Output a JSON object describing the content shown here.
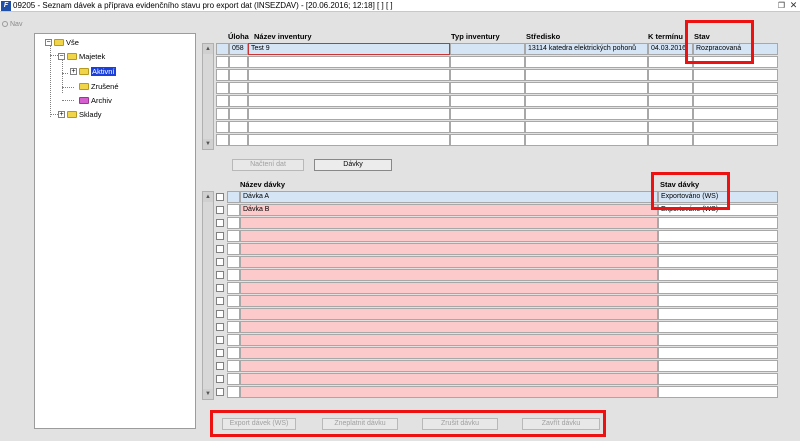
{
  "window": {
    "title": "09205 - Seznam dávek a příprava evidenčního stavu pro export dat (INSEZDAV) - [20.06.2016; 12:18]  [ ]  [ ]",
    "app_icon": "F"
  },
  "nav": {
    "label": "Nav"
  },
  "tree": {
    "root": "Vše",
    "majetek": "Majetek",
    "aktivni": "Aktivní",
    "zrusene": "Zrušené",
    "archiv": "Archiv",
    "sklady": "Sklady"
  },
  "inventory_grid": {
    "headers": {
      "uloha": "Úloha",
      "nazev": "Název inventury",
      "typ": "Typ inventury",
      "stredisko": "Středisko",
      "k_terminu": "K termínu",
      "stav": "Stav"
    },
    "rows": [
      {
        "uloha": "058",
        "nazev": "Test 9",
        "typ": "",
        "stredisko": "13114 katedra elektrických pohonů",
        "k_terminu": "04.03.2016",
        "stav": "Rozpracovaná"
      }
    ]
  },
  "mid_buttons": {
    "nacteni": "Načtení dat",
    "davky": "Dávky"
  },
  "batch_grid": {
    "headers": {
      "nazev": "Název dávky",
      "stav": "Stav dávky"
    },
    "rows": [
      {
        "nazev": "Dávka A",
        "stav": "Exportováno (WS)"
      },
      {
        "nazev": "Dávka B",
        "stav": "Exportováno (WS)"
      }
    ]
  },
  "bottom_buttons": {
    "export": "Export dávek (WS)",
    "zneplatnit": "Zneplatnit dávku",
    "zrusit": "Zrušit dávku",
    "zavrit": "Zavřít dávku"
  },
  "colors": {
    "highlight_red": "#ee1111",
    "row_selected": "#d5e5f5",
    "row_pink": "#fccaca",
    "tree_selected": "#1a3fdc"
  }
}
